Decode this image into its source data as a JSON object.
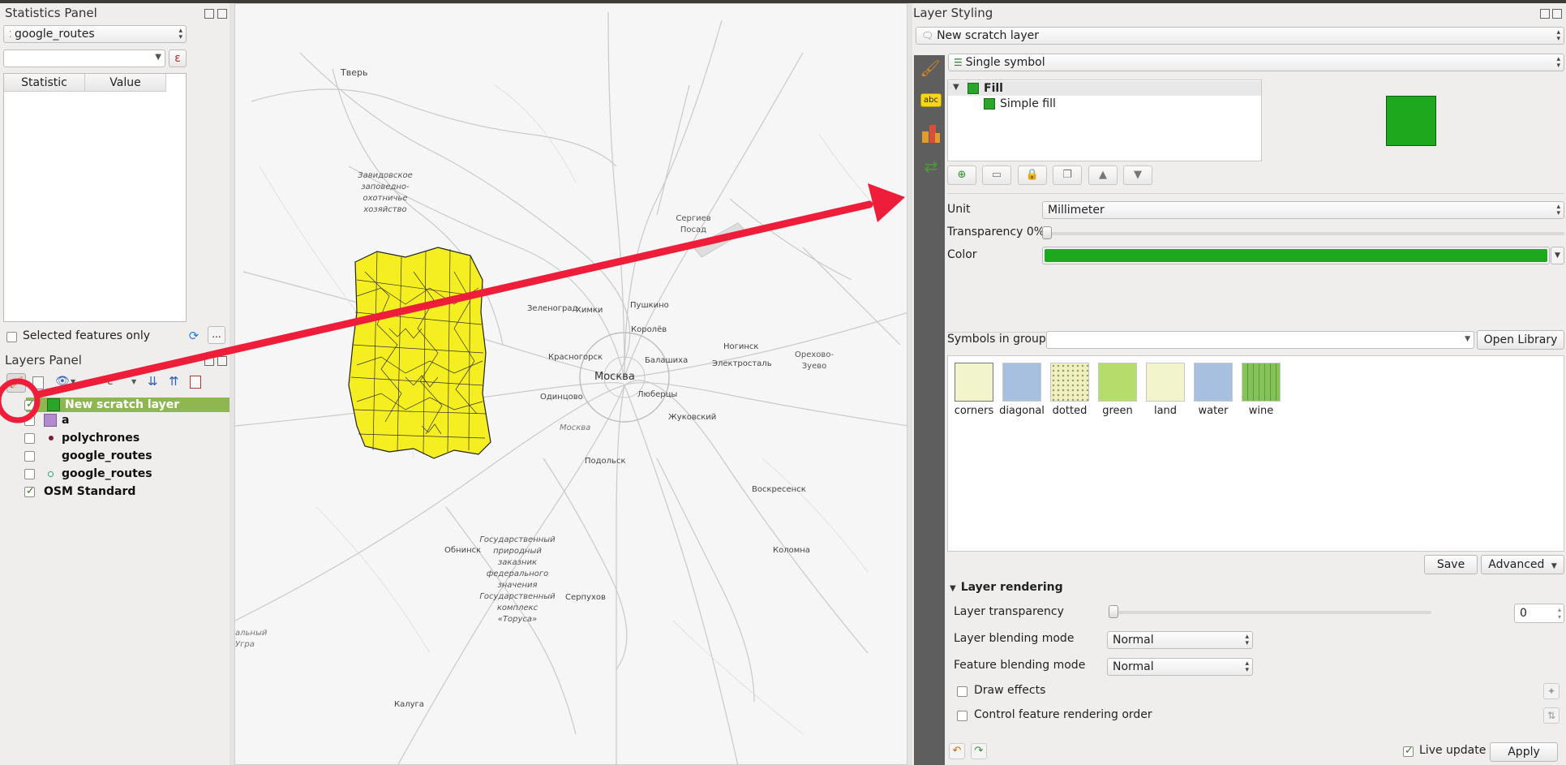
{
  "statistics_panel": {
    "title": "Statistics Panel",
    "layer_combo": "google_routes",
    "expression_value": "",
    "epsilon_icon": "ε",
    "col_statistic": "Statistic",
    "col_value": "Value",
    "selected_only_label": "Selected features only",
    "more_label": "..."
  },
  "layers_panel": {
    "title": "Layers Panel",
    "layers": [
      {
        "name": "New scratch layer",
        "checked": true,
        "swatch": "#2aa52a"
      },
      {
        "name": "a",
        "checked": false,
        "swatch": "#b28ad0"
      },
      {
        "name": "polychrones",
        "checked": false,
        "marker": "dot-dark-red"
      },
      {
        "name": "google_routes",
        "checked": false,
        "marker": "none"
      },
      {
        "name": "google_routes",
        "checked": false,
        "marker": "circle-green"
      },
      {
        "name": "OSM Standard",
        "checked": true
      }
    ]
  },
  "map": {
    "cities": [
      "Тверь",
      "Завидовское заповедно-охотничье хозяйство",
      "Сергиев Посад",
      "Зеленоград",
      "Пушкино",
      "Химки",
      "Королёв",
      "Красногорск",
      "Балашиха",
      "Ногинск",
      "Орехово-Зуево",
      "Электросталь",
      "Москва",
      "Одинцово",
      "Люберцы",
      "Москва",
      "Жуковский",
      "Подольск",
      "Воскресенск",
      "Обнинск",
      "Государственный природный заказник федерального значения Государственный комплекс «Торуса»",
      "Коломна",
      "Серпухов",
      "Калуга",
      "альный",
      "Угра"
    ]
  },
  "layer_styling": {
    "title": "Layer Styling",
    "layer_combo": "New scratch layer",
    "renderer_combo": "Single symbol",
    "tree": {
      "fill": "Fill",
      "simple_fill": "Simple fill"
    },
    "preview_color": "#1ea81e",
    "unit_label": "Unit",
    "unit_value": "Millimeter",
    "transparency_label": "Transparency 0%",
    "color_label": "Color",
    "color_value": "#1ea81e",
    "symbols_in_group_label": "Symbols in group",
    "symbols_group_value": "",
    "open_library": "Open Library",
    "symbols": [
      {
        "name": "corners",
        "color": "#f2f5cc"
      },
      {
        "name": "diagonal",
        "color": "#a7c0e0"
      },
      {
        "name": "dotted",
        "color": "#eef0c0"
      },
      {
        "name": "green",
        "color": "#b6dd6b"
      },
      {
        "name": "land",
        "color": "#f2f5cc"
      },
      {
        "name": "water",
        "color": "#a7c0e0"
      },
      {
        "name": "wine",
        "color": "#86c25a"
      }
    ],
    "save": "Save",
    "advanced": "Advanced",
    "layer_rendering": "Layer rendering",
    "layer_transparency_label": "Layer transparency",
    "layer_transparency_value": "0",
    "layer_blending_label": "Layer blending mode",
    "layer_blending_value": "Normal",
    "feature_blending_label": "Feature blending mode",
    "feature_blending_value": "Normal",
    "draw_effects": "Draw effects",
    "control_order": "Control feature rendering order",
    "live_update": "Live update",
    "apply": "Apply"
  }
}
